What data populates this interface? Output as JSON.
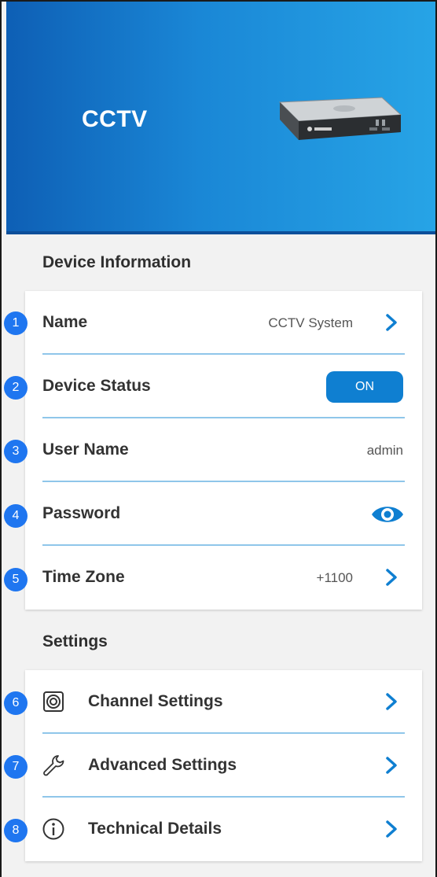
{
  "header": {
    "title": "CCTV",
    "device_image_icon": "dvr-recorder"
  },
  "device_information": {
    "section_title": "Device Information",
    "rows": [
      {
        "badge": "1",
        "label": "Name",
        "value": "CCTV System",
        "icon": "chevron-right-icon"
      },
      {
        "badge": "2",
        "label": "Device Status",
        "toggle": "ON"
      },
      {
        "badge": "3",
        "label": "User Name",
        "value": "admin"
      },
      {
        "badge": "4",
        "label": "Password",
        "icon": "eye-icon"
      },
      {
        "badge": "5",
        "label": "Time Zone",
        "value": "+1100",
        "icon": "chevron-right-icon"
      }
    ]
  },
  "settings": {
    "section_title": "Settings",
    "rows": [
      {
        "badge": "6",
        "label": "Channel Settings",
        "icon": "channel-icon"
      },
      {
        "badge": "7",
        "label": "Advanced Settings",
        "icon": "wrench-icon"
      },
      {
        "badge": "8",
        "label": "Technical Details",
        "icon": "info-icon"
      }
    ]
  },
  "colors": {
    "accent": "#0f7fd1",
    "badge": "#1f76f0",
    "divider": "#8fc6ea",
    "header_start": "#0e5fb5",
    "header_end": "#27a4e6"
  }
}
